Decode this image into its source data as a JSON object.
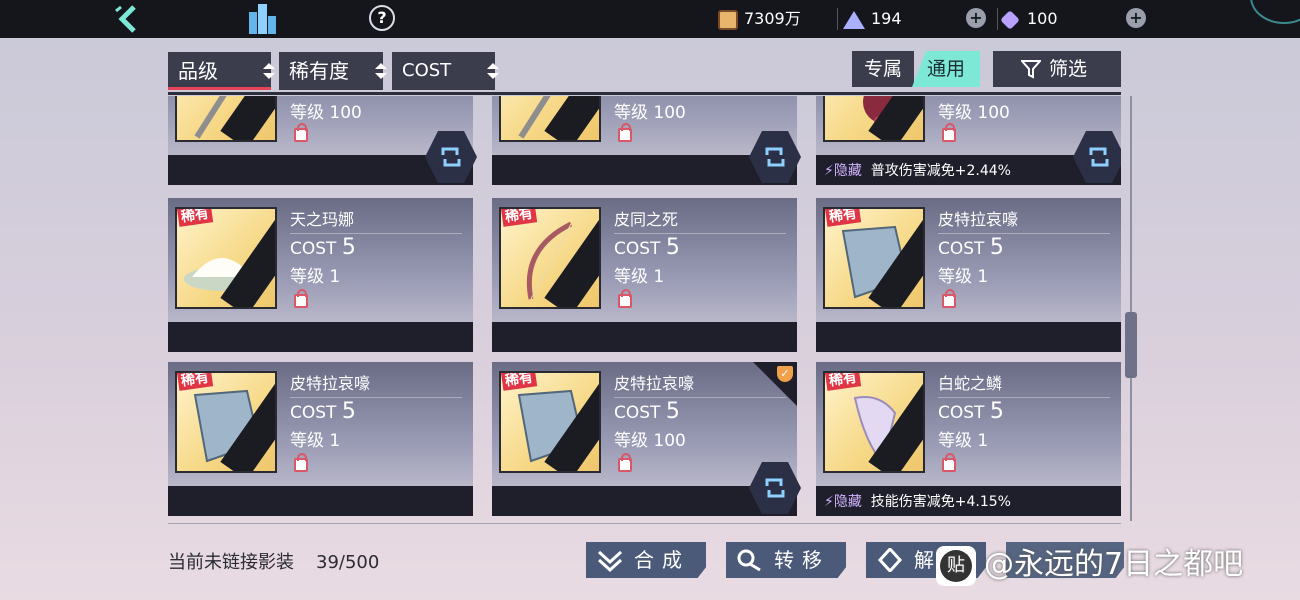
{
  "topbar": {
    "coins": "7309万",
    "tickets": "194",
    "gems": "100",
    "plus": "+"
  },
  "filters": {
    "grade_label": "品级",
    "rarity_label": "稀有度",
    "cost_label": "COST",
    "exclusive_label": "专属",
    "general_label": "通用",
    "filter_label": "筛选"
  },
  "cards": [
    {
      "name": "",
      "cost": "",
      "level": "等级 100",
      "link": true,
      "hidden": null
    },
    {
      "name": "",
      "cost": "",
      "level": "等级 100",
      "link": true,
      "hidden": null
    },
    {
      "name": "",
      "cost": "",
      "level": "等级 100",
      "link": true,
      "hidden": {
        "tag": "隐藏",
        "effect": "普攻伤害减免+2.44%"
      }
    },
    {
      "name": "天之玛娜",
      "badge": "稀有",
      "cost_prefix": "COST",
      "cost": "5",
      "level": "等级 1"
    },
    {
      "name": "皮同之死",
      "badge": "稀有",
      "cost_prefix": "COST",
      "cost": "5",
      "level": "等级 1"
    },
    {
      "name": "皮特拉哀嚎",
      "badge": "稀有",
      "cost_prefix": "COST",
      "cost": "5",
      "level": "等级 1"
    },
    {
      "name": "皮特拉哀嚎",
      "badge": "稀有",
      "cost_prefix": "COST",
      "cost": "5",
      "level": "等级 1"
    },
    {
      "name": "皮特拉哀嚎",
      "badge": "稀有",
      "cost_prefix": "COST",
      "cost": "5",
      "level": "等级 100"
    },
    {
      "name": "白蛇之鳞",
      "badge": "稀有",
      "cost_prefix": "COST",
      "cost": "5",
      "level": "等级 1",
      "hidden": {
        "tag": "隐藏",
        "effect": "技能伤害减免+4.15%"
      }
    }
  ],
  "footer": {
    "status_label": "当前未链接影装",
    "status_count": "39/500",
    "merge_label": "合成",
    "transfer_label": "转移",
    "decompose_label": "解",
    "watermark_text": "@永远的7日之都吧"
  },
  "colors": {
    "accent_red": "#e74457",
    "toggle_active": "#7ee8d6",
    "panel_dark": "#3b3d4d"
  }
}
